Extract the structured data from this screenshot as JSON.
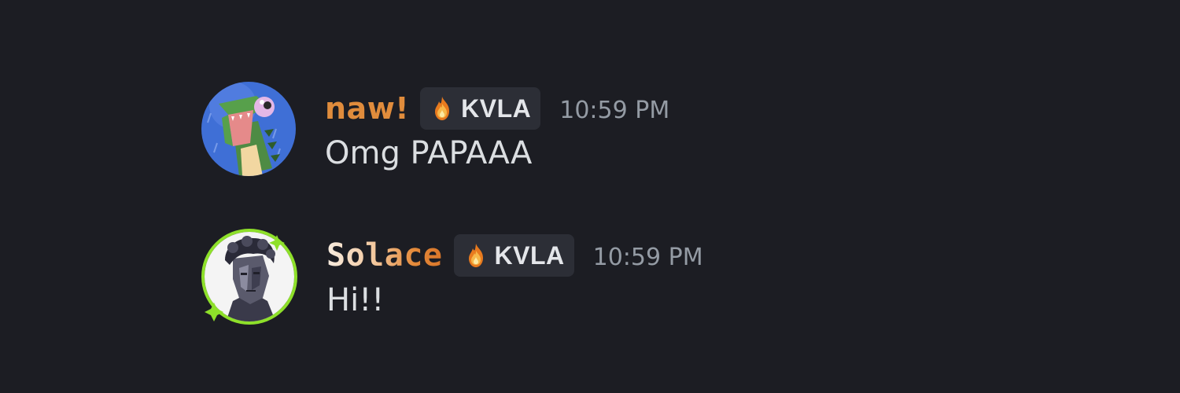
{
  "messages": [
    {
      "username": "naw!",
      "username_color": "#e08c3c",
      "avatar_icon": "crocodile-avatar-icon",
      "badge": {
        "icon": "fire-icon",
        "label": "KVLA"
      },
      "timestamp": "10:59 PM",
      "text": "Omg PAPAAA"
    },
    {
      "username": "Solace",
      "username_color": "#e08c3c",
      "avatar_icon": "statue-avatar-icon",
      "avatar_ring_color": "#8ee02a",
      "badge": {
        "icon": "fire-icon",
        "label": "KVLA"
      },
      "timestamp": "10:59 PM",
      "text": "Hi!!"
    }
  ],
  "colors": {
    "background": "#1c1d23",
    "badge_background": "#2c2e36",
    "timestamp": "#949ba4",
    "message_text": "#dbdee1"
  }
}
